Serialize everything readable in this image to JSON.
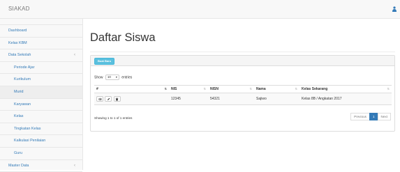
{
  "app": {
    "brand": "SIAKAD"
  },
  "sidebar": {
    "items": [
      {
        "label": "Dashboard",
        "sub": false,
        "active": false,
        "caret": ""
      },
      {
        "label": "Kelas KBM",
        "sub": false,
        "active": false,
        "caret": ""
      },
      {
        "label": "Data Sekolah",
        "sub": false,
        "active": false,
        "caret": "‹"
      },
      {
        "label": "Periode Ajar",
        "sub": true,
        "active": false,
        "caret": ""
      },
      {
        "label": "Kurikulum",
        "sub": true,
        "active": false,
        "caret": ""
      },
      {
        "label": "Murid",
        "sub": true,
        "active": true,
        "caret": ""
      },
      {
        "label": "Karyawan",
        "sub": true,
        "active": false,
        "caret": ""
      },
      {
        "label": "Kelas",
        "sub": true,
        "active": false,
        "caret": ""
      },
      {
        "label": "Tingkatan Kelas",
        "sub": true,
        "active": false,
        "caret": ""
      },
      {
        "label": "Kalkulasi Penilaian",
        "sub": true,
        "active": false,
        "caret": ""
      },
      {
        "label": "Guru",
        "sub": true,
        "active": false,
        "caret": ""
      },
      {
        "label": "Master Data",
        "sub": false,
        "active": false,
        "caret": "‹"
      }
    ]
  },
  "main": {
    "title": "Daftar Siswa",
    "add_button": "Buat Baru",
    "show_prefix": "Show",
    "show_value": "10",
    "show_suffix": "entries",
    "table": {
      "headers": [
        "#",
        "NIS",
        "NISN",
        "Nama",
        "Kelas Sekarang"
      ],
      "rows": [
        {
          "nis": "12345",
          "nisn": "54321",
          "nama": "Sajiwo",
          "kelas": "Kelas 8B / Angkatan 2017"
        }
      ]
    },
    "info": "Showing 1 to 1 of 1 entries",
    "pagination": {
      "prev": "Previous",
      "current": "1",
      "next": "Next"
    }
  },
  "colors": {
    "accent": "#337ab7",
    "info_button": "#5bc0de"
  },
  "icons": {
    "row_actions": [
      "eye-icon",
      "pencil-icon",
      "trash-icon"
    ],
    "user": "user-icon"
  }
}
